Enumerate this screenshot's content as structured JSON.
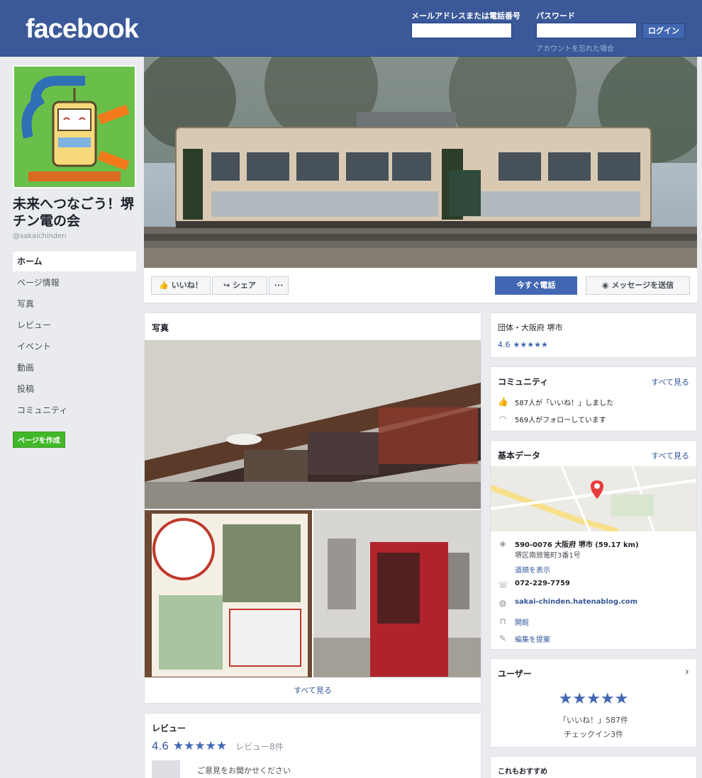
{
  "header": {
    "logo": "facebook",
    "email_label": "メールアドレスまたは電話番号",
    "password_label": "パスワード",
    "login_button": "ログイン",
    "forgot_link": "アカウントを忘れた場合"
  },
  "colors": {
    "brand": "#3b5998",
    "primary_button": "#4267b2",
    "create_page": "#42b72a",
    "link": "#365899"
  },
  "sidebar": {
    "page_name": "未来へつなごう！堺チン電の会",
    "page_handle": "@sakaichinden",
    "nav": [
      {
        "label": "ホーム",
        "active": true
      },
      {
        "label": "ページ情報"
      },
      {
        "label": "写真"
      },
      {
        "label": "レビュー"
      },
      {
        "label": "イベント"
      },
      {
        "label": "動画"
      },
      {
        "label": "投稿"
      },
      {
        "label": "コミュニティ"
      }
    ],
    "create_page": "ページを作成"
  },
  "actions": {
    "like": "いいね！",
    "share": "シェア",
    "more": "···",
    "contact": "今すぐ電話",
    "message": "メッセージを送信"
  },
  "photos": {
    "title": "写真",
    "see_all": "すべて見る"
  },
  "reviews": {
    "title": "レビュー",
    "rating": "4.6",
    "count": "レビュー8件",
    "prompt": "ご意見をお聞かせください"
  },
  "about": {
    "category": "団体・大阪府 堺市",
    "rating": "4.6"
  },
  "community": {
    "title": "コミュニティ",
    "see_all": "すべて見る",
    "likes": "587人が「いいね！」しました",
    "follows": "569人がフォローしています"
  },
  "basic": {
    "title": "基本データ",
    "see_all": "すべて見る",
    "address": "590-0076 大阪府 堺市 (59.17 km)",
    "address2": "堺区南旅篭町3番1号",
    "directions": "道順を表示",
    "phone": "072-229-7759",
    "website": "sakai-chinden.hatenablog.com",
    "hours": "開館",
    "suggest": "編集を提案"
  },
  "users": {
    "title": "ユーザー",
    "likes_line": "「いいね！」587件",
    "checkins_line": "チェックイン3件"
  },
  "recommend": {
    "title": "これもおすすめ"
  }
}
